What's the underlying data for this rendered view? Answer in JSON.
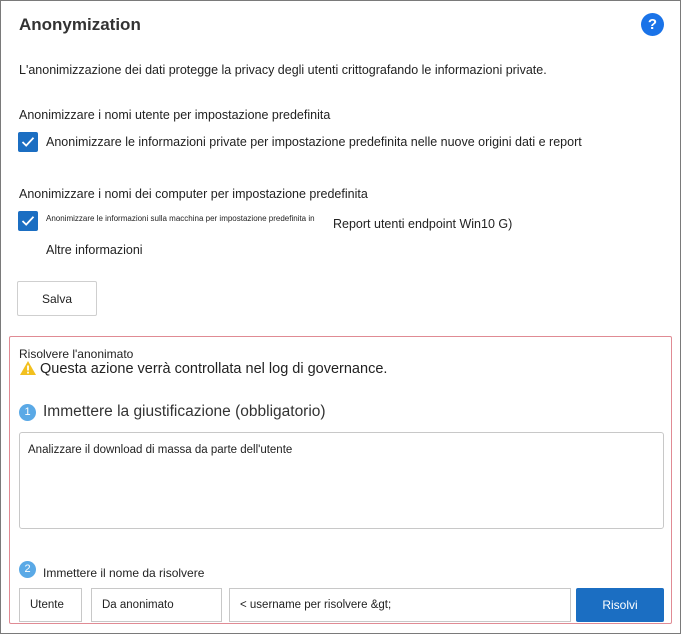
{
  "header": {
    "title": "Anonymization",
    "help_label": "?"
  },
  "description": "L'anonimizzazione dei dati protegge la privacy degli utenti crittografando le informazioni private.",
  "users_section": {
    "heading": "Anonimizzare i nomi utente per impostazione predefinita",
    "checkbox_label": "Anonimizzare le informazioni private per impostazione predefinita nelle nuove origini dati e report",
    "checked": true
  },
  "computers_section": {
    "heading": "Anonimizzare i nomi dei computer per impostazione predefinita",
    "checkbox_label": "Anonimizzare le informazioni sulla macchina per impostazione predefinita in",
    "report_label": "Report utenti endpoint Win10 G)",
    "more_info": "Altre informazioni",
    "checked": true
  },
  "save_label": "Salva",
  "resolve_panel": {
    "title": "Risolvere l'anonimato",
    "warning": "Questa azione verrà controllata nel log di governance.",
    "step1": {
      "number": "1",
      "label": "Immettere la giustificazione (obbligatorio)",
      "value": "Analizzare il download di massa da parte dell'utente"
    },
    "step2": {
      "number": "2",
      "label": "Immettere il nome da risolvere",
      "type_value": "Utente",
      "mode_value": "Da anonimato",
      "name_placeholder": "< username per risolvere &gt;",
      "resolve_label": "Risolvi"
    }
  },
  "colors": {
    "accent": "#1b6ec2",
    "panel_border": "#e08b94",
    "step_circle": "#5aa9e6",
    "warning": "#f2c01e"
  }
}
